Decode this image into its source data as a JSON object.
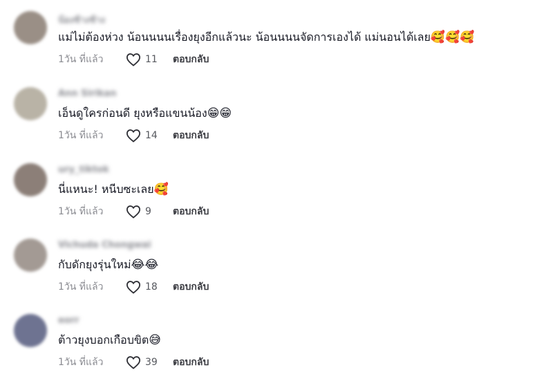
{
  "comments": [
    {
      "username": "น้องช้างช้าง",
      "avatar_color": "#9a8f86",
      "text": "แม่ไม่ต้องห่วง น้อนนนนเรื่องยุงอีกแล้วนะ น้อนนนนจัดการเองได้ แม่นอนได้เลย",
      "emojis": "🥰🥰🥰",
      "time": "1วัน ที่แล้ว",
      "likes": "11",
      "reply_label": "ตอบกลับ"
    },
    {
      "username": "Ann Sirikan",
      "avatar_color": "#b9b3a6",
      "text": "เอ็นดูใครก่อนดี ยุงหรือแขนน้อง",
      "emojis": "😁😁",
      "time": "1วัน ที่แล้ว",
      "likes": "14",
      "reply_label": "ตอบกลับ"
    },
    {
      "username": "ury_tiktok",
      "avatar_color": "#8c7f78",
      "text": "นี่แหนะ! หนีบซะเลย",
      "emojis": "🥰",
      "time": "1วัน ที่แล้ว",
      "likes": "9",
      "reply_label": "ตอบกลับ"
    },
    {
      "username": "Vichuda Chongwai",
      "avatar_color": "#a39a94",
      "text": "กับดักยุงรุ่นใหม่",
      "emojis": "😂😂",
      "time": "1วัน ที่แล้ว",
      "likes": "18",
      "reply_label": "ตอบกลับ"
    },
    {
      "username": "eorr",
      "avatar_color": "#6e7391",
      "text": "ต้าวยุงบอกเกือบขิต",
      "emojis": "😅",
      "time": "1วัน ที่แล้ว",
      "likes": "39",
      "reply_label": "ตอบกลับ"
    }
  ]
}
